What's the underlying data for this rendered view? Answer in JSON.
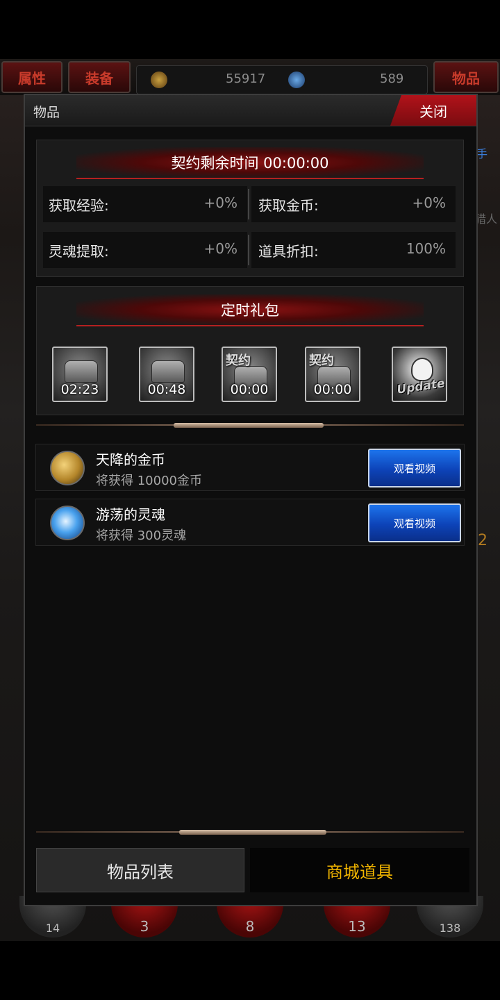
{
  "background": {
    "tabs": [
      "属性",
      "装备",
      "物品"
    ],
    "resources": {
      "gold": "55917",
      "soul": "589"
    },
    "side_text_right": [
      "手",
      "猎人"
    ],
    "side_num_right": "2",
    "bottom_counts": [
      "14",
      "3",
      "8",
      "13",
      "138"
    ]
  },
  "dialog": {
    "title": "物品",
    "close_label": "关闭",
    "contract": {
      "banner": "契约剩余时间 00:00:00",
      "stats": [
        {
          "label": "获取经验:",
          "value": "+0%"
        },
        {
          "label": "获取金币:",
          "value": "+0%"
        },
        {
          "label": "灵魂提取:",
          "value": "+0%"
        },
        {
          "label": "道具折扣:",
          "value": "100%"
        }
      ]
    },
    "gifts": {
      "banner": "定时礼包",
      "items": [
        {
          "timer": "02:23",
          "tag": "",
          "icon": "chest-icon"
        },
        {
          "timer": "00:48",
          "tag": "",
          "icon": "chest-icon"
        },
        {
          "timer": "00:00",
          "tag": "契约",
          "icon": "contract-chest-icon"
        },
        {
          "timer": "00:00",
          "tag": "契约",
          "icon": "contract-chest-icon"
        },
        {
          "timer": "",
          "tag": "Update",
          "icon": "skull-update-icon"
        }
      ]
    },
    "rewards": [
      {
        "name": "天降的金币",
        "desc": "将获得 10000金币",
        "button": "观看视频",
        "icon": "gold-coins-icon",
        "color": "#c9a040"
      },
      {
        "name": "游荡的灵魂",
        "desc": "将获得 300灵魂",
        "button": "观看视频",
        "icon": "soul-crystal-icon",
        "color": "#3a8ee6"
      }
    ],
    "bottom_tabs": [
      {
        "label": "物品列表",
        "active": false
      },
      {
        "label": "商城道具",
        "active": true
      }
    ],
    "colors": {
      "accent_red": "#b1121a",
      "active_tab": "#f0b400",
      "watch_button": "#1d74ec"
    }
  }
}
